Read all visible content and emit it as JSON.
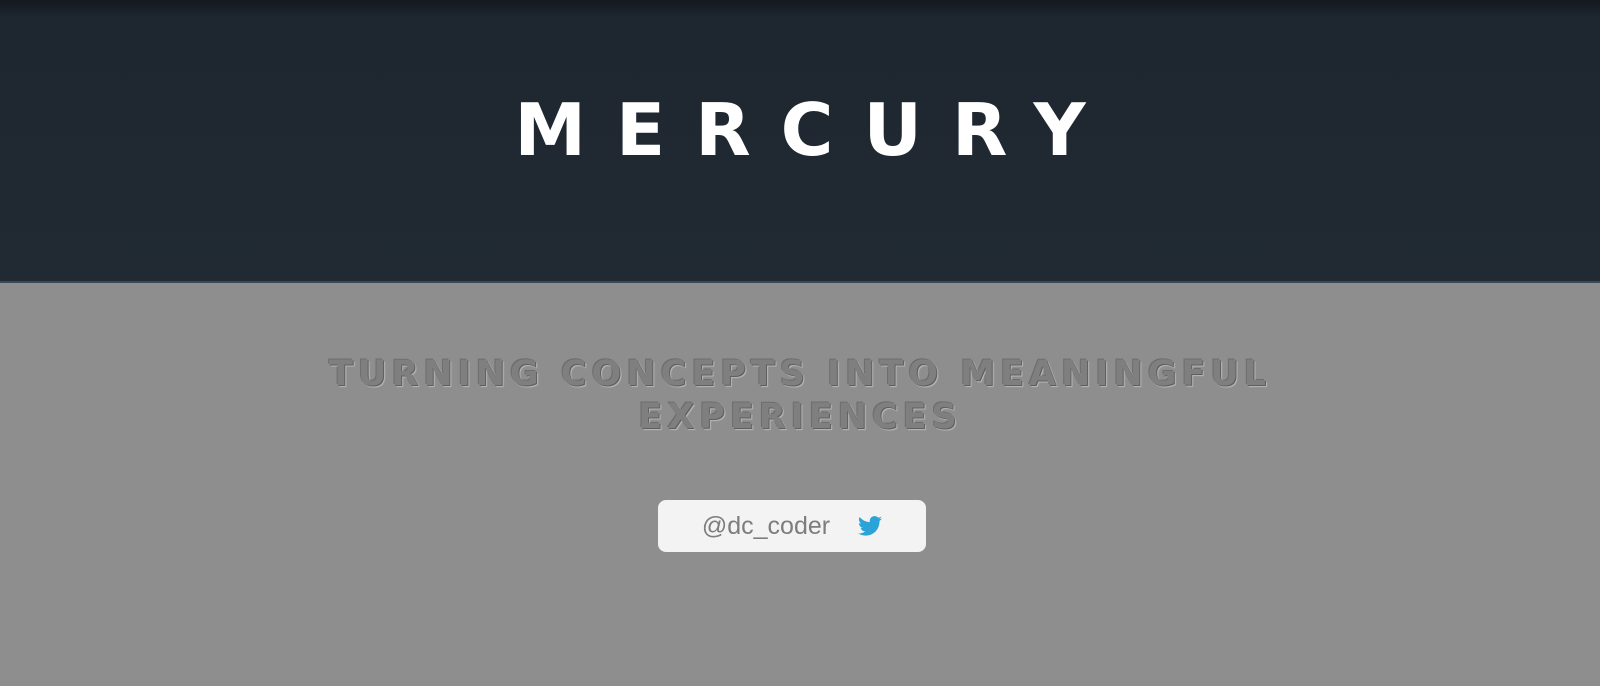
{
  "header": {
    "title": "MERCURY"
  },
  "main": {
    "tagline": "TURNING CONCEPTS INTO MEANINGFUL EXPERIENCES",
    "twitter_button": {
      "handle": "@dc_coder",
      "icon": "twitter-bird-icon",
      "icon_color": "#2aa3d8"
    }
  },
  "colors": {
    "header_bg": "#212a33",
    "content_bg": "#8e8e8e",
    "title_text": "#ffffff",
    "tagline_text": "#7f7f7f",
    "button_bg": "#f3f3f3"
  }
}
